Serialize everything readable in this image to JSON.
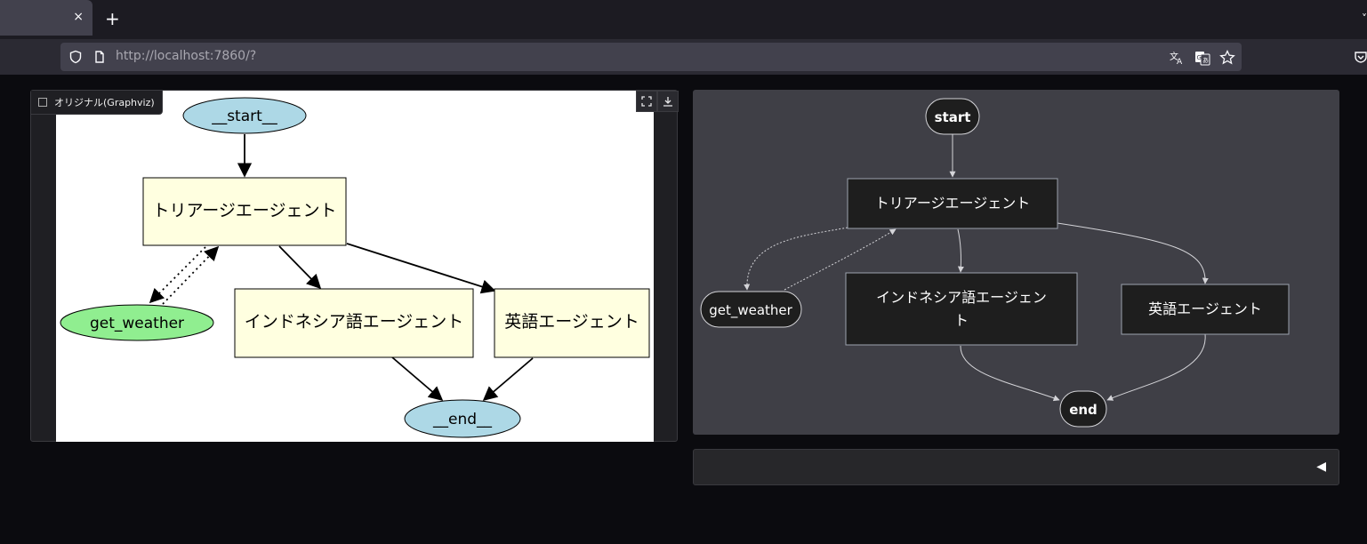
{
  "browser": {
    "tab_close": "×",
    "new_tab": "+",
    "tab_menu": "˅",
    "url_host": "http://localhost",
    "url_rest": ":7860/?"
  },
  "left_panel": {
    "label": "オリジナル(Graphviz)",
    "nodes": {
      "start": "__start__",
      "triage": "トリアージエージェント",
      "weather": "get_weather",
      "indo": "インドネシア語エージェント",
      "english": "英語エージェント",
      "end": "__end__"
    },
    "colors": {
      "terminal": "#add8e6",
      "agent": "#ffffe0",
      "tool": "#90ee90"
    }
  },
  "right_panel": {
    "nodes": {
      "start": "start",
      "triage": "トリアージエージェント",
      "weather": "get_weather",
      "indo_line1": "インドネシア語エージェン",
      "indo_line2": "ト",
      "english": "英語エージェント",
      "end": "end"
    },
    "colors": {
      "background": "#3f3f46",
      "node": "#1e1e1e"
    }
  },
  "bottom_bar": {
    "play_icon": "◀"
  }
}
